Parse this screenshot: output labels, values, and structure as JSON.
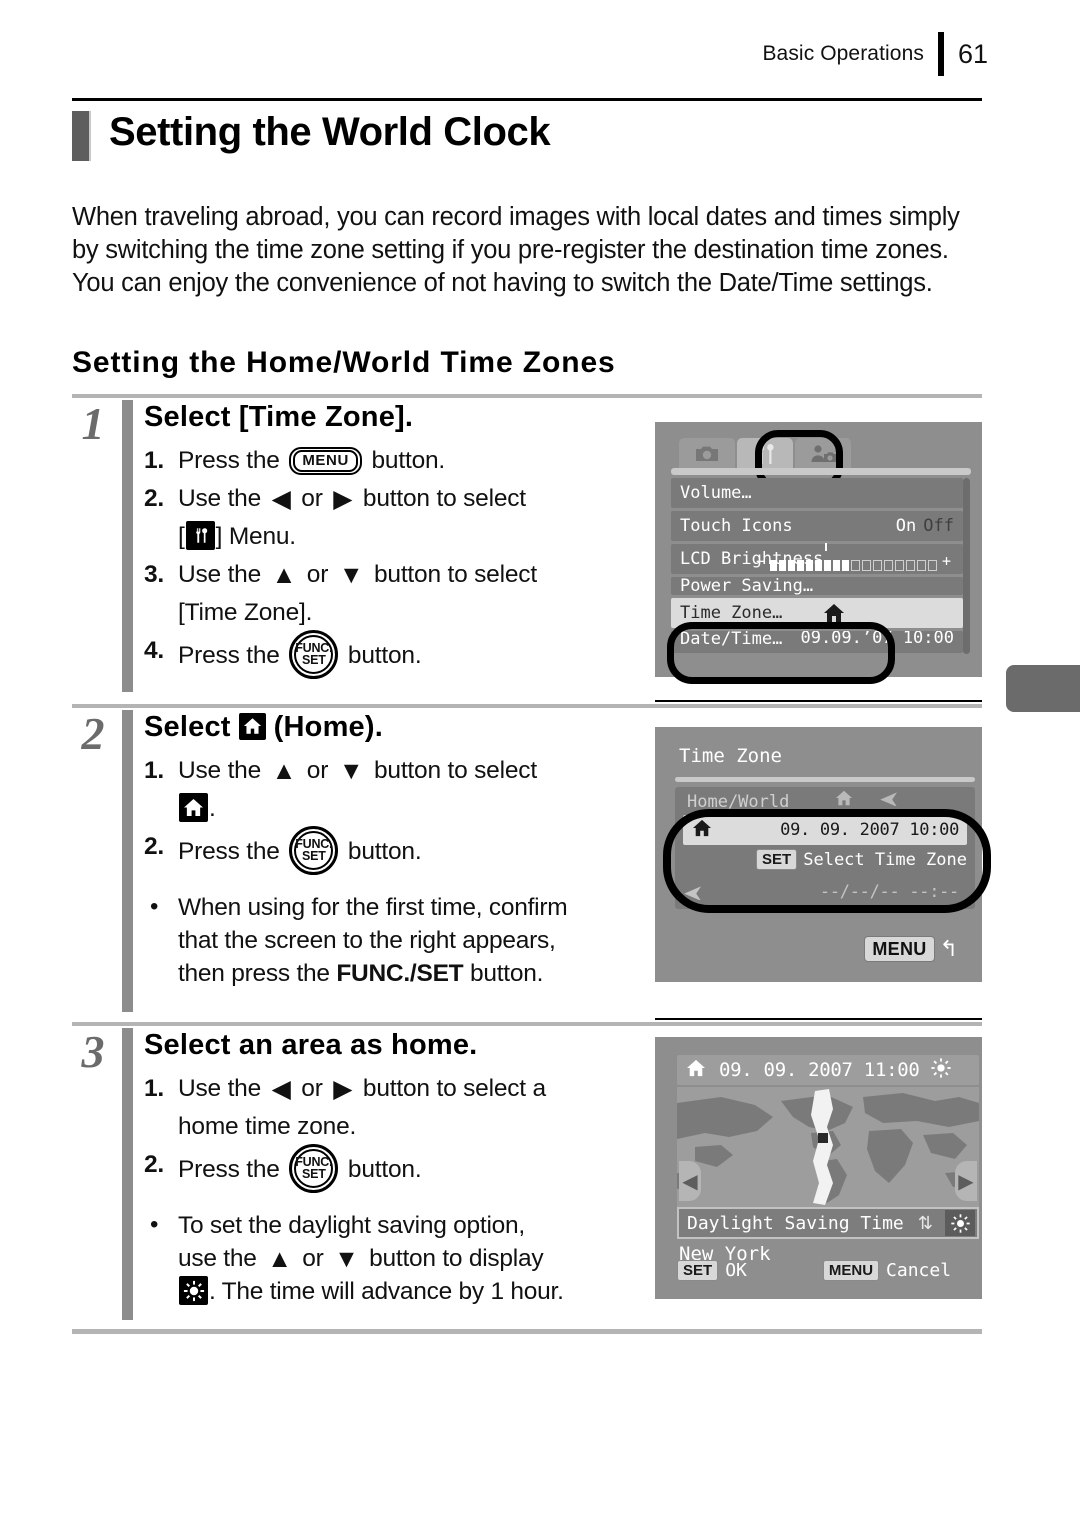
{
  "running_head": {
    "chapter": "Basic Operations",
    "page_number": "61"
  },
  "chapter_title": "Setting the World Clock",
  "intro_paragraph": "When traveling abroad, you can record images with local dates and times simply by switching the time zone setting if you pre-register the destination time zones. You can enjoy the convenience of not having to switch the Date/Time settings.",
  "section_heading": "Setting the Home/World Time Zones",
  "steps": [
    {
      "number": "1",
      "title": "Select [Time Zone].",
      "items": [
        {
          "marker": "1.",
          "parts": [
            "Press the ",
            "MENU-BUTTON",
            " button."
          ]
        },
        {
          "marker": "2.",
          "parts": [
            "Use the ",
            "LEFT",
            " or ",
            "RIGHT",
            " button to select [",
            "TOOLS-ICON",
            "] Menu."
          ]
        },
        {
          "marker": "3.",
          "parts": [
            "Use the ",
            "UP",
            " or ",
            "DOWN",
            " button to select [Time Zone]."
          ]
        },
        {
          "marker": "4.",
          "parts": [
            "Press the ",
            "FUNCSET-BUTTON",
            " button."
          ]
        }
      ],
      "bullets": []
    },
    {
      "number": "2",
      "title_prefix": "Select ",
      "title_suffix": " (Home).",
      "items": [
        {
          "marker": "1.",
          "parts": [
            "Use the ",
            "UP",
            " or ",
            "DOWN",
            " button to select ",
            "HOME-ICON",
            "."
          ]
        },
        {
          "marker": "2.",
          "parts": [
            "Press the ",
            "FUNCSET-BUTTON",
            " button."
          ]
        }
      ],
      "bullets": [
        "When using for the first time, confirm that the screen to the right appears, then press the FUNC./SET button."
      ],
      "bullet_bold_fragment": "FUNC./SET"
    },
    {
      "number": "3",
      "title": "Select an area as home.",
      "items": [
        {
          "marker": "1.",
          "parts": [
            "Use the ",
            "LEFT",
            " or ",
            "RIGHT",
            " button to select a home time zone."
          ]
        },
        {
          "marker": "2.",
          "parts": [
            "Press the ",
            "FUNCSET-BUTTON",
            " button."
          ]
        }
      ],
      "bullets": [
        "To set the daylight saving option, use the UP or DOWN button to display SUN-ICON. The time will advance by 1 hour."
      ]
    }
  ],
  "step_text": {
    "s1_i1_a": "Press the ",
    "s1_i1_b": " button.",
    "s1_i2_a": "Use the ",
    "s1_i2_or": " or ",
    "s1_i2_b": " button to select",
    "s1_i2_c": "] Menu.",
    "s1_i3_b": " button to select",
    "s1_i3_c": "[Time Zone].",
    "s1_i4_a": "Press the ",
    "s1_i4_b": " button.",
    "s2_title_pre": "Select ",
    "s2_title_post": " (Home).",
    "s2_i1_a": "Use the ",
    "s2_i1_b": " button to select",
    "s2_i1_c": ".",
    "s2_i2_a": "Press the ",
    "s2_i2_b": " button.",
    "s2_b1_l1": "When using for the first time, confirm",
    "s2_b1_l2": "that the screen to the right appears,",
    "s2_b1_l3a": "then press the ",
    "s2_b1_l3b": "FUNC./SET",
    "s2_b1_l3c": " button.",
    "s3_i1_a": "Use the ",
    "s3_i1_b": " button to select a",
    "s3_i1_c": "home time zone.",
    "s3_i2_a": "Press the ",
    "s3_i2_b": " button.",
    "s3_b1_l1": "To set the daylight saving option,",
    "s3_b1_l2a": "use the ",
    "s3_b1_l2b": " button to display",
    "s3_b1_l3": ". The time will advance by 1 hour.",
    "bracket_open": "[",
    "bracket_close": "]",
    "or": " or ",
    "bullet_dot": "•",
    "arrow_left": "◀",
    "arrow_right": "▶",
    "arrow_up": "▲",
    "arrow_down": "▼"
  },
  "glyphs": {
    "menu_button_label": "MENU",
    "func_label_top": "FUNC.",
    "func_label_bottom": "SET"
  },
  "screens": {
    "menu_screen": {
      "tabs": [
        "camera-icon",
        "tools-icon",
        "playback-setup-icon"
      ],
      "selected_tab": "tools-icon",
      "rows": [
        {
          "label": "Volume…",
          "value": ""
        },
        {
          "label": "Touch Icons",
          "value_on": "On",
          "value_off": "Off"
        },
        {
          "label": "LCD Brightness",
          "value": "slider",
          "slider_minus": "−",
          "slider_plus": "+",
          "filled": 9,
          "empty": 8
        },
        {
          "label": "Power Saving…",
          "value": ""
        },
        {
          "label": "Time Zone…",
          "value": "home-icon",
          "highlighted": true
        },
        {
          "label": "Date/Time…",
          "value": "09.09.’07 10:00"
        }
      ]
    },
    "time_zone_screen": {
      "title": "Time Zone",
      "home_world_label": "Home/World",
      "home_date": "09. 09. 2007 10:00",
      "set_key": "SET",
      "set_action": "Select Time Zone",
      "world_date": "--/--/-- --:--",
      "menu_key": "MENU",
      "back_arrow": "↰"
    },
    "world_map_screen": {
      "datetime": "09. 09. 2007 11:00",
      "daylight_label": "Daylight Saving Time",
      "city": "New York",
      "set_key": "SET",
      "set_action": "OK",
      "menu_key": "MENU",
      "menu_action": "Cancel"
    }
  }
}
